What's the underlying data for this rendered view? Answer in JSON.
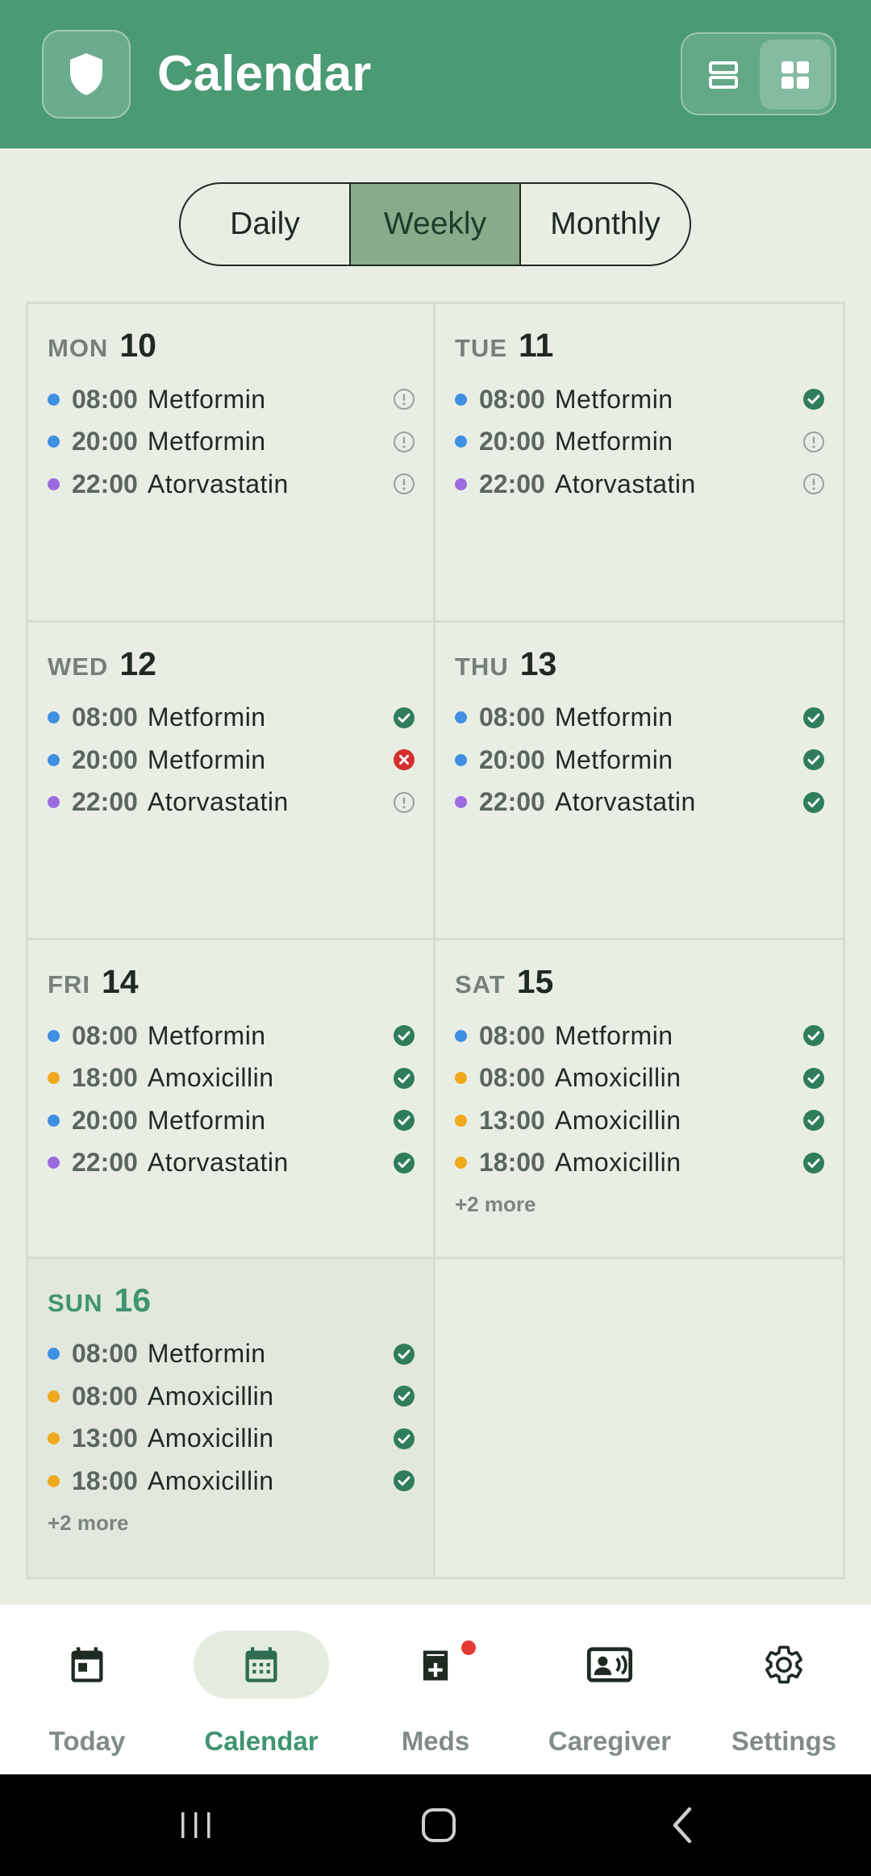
{
  "header": {
    "title": "Calendar",
    "icon": "shield-icon",
    "view_modes": [
      "list-view-icon",
      "grid-view-icon"
    ],
    "active_view": "grid",
    "bg_color": "#4a9a74"
  },
  "tabs": [
    {
      "label": "Daily",
      "active": false
    },
    {
      "label": "Weekly",
      "active": true
    },
    {
      "label": "Monthly",
      "active": false
    }
  ],
  "colors": {
    "metformin": "#3f8fe3",
    "atorvastatin": "#9b6ce0",
    "amoxicillin": "#f0a91c",
    "taken": "#2f7d5b",
    "missed": "#d32f2f",
    "pending": "#9aa29d"
  },
  "days": [
    {
      "dow": "MON",
      "num": "10",
      "today": false,
      "entries": [
        {
          "time": "08:00",
          "med": "Metformin",
          "color": "metformin",
          "status": "pending"
        },
        {
          "time": "20:00",
          "med": "Metformin",
          "color": "metformin",
          "status": "pending"
        },
        {
          "time": "22:00",
          "med": "Atorvastatin",
          "color": "atorvastatin",
          "status": "pending"
        }
      ],
      "more": ""
    },
    {
      "dow": "TUE",
      "num": "11",
      "today": false,
      "entries": [
        {
          "time": "08:00",
          "med": "Metformin",
          "color": "metformin",
          "status": "taken"
        },
        {
          "time": "20:00",
          "med": "Metformin",
          "color": "metformin",
          "status": "pending"
        },
        {
          "time": "22:00",
          "med": "Atorvastatin",
          "color": "atorvastatin",
          "status": "pending"
        }
      ],
      "more": ""
    },
    {
      "dow": "WED",
      "num": "12",
      "today": false,
      "entries": [
        {
          "time": "08:00",
          "med": "Metformin",
          "color": "metformin",
          "status": "taken"
        },
        {
          "time": "20:00",
          "med": "Metformin",
          "color": "metformin",
          "status": "missed"
        },
        {
          "time": "22:00",
          "med": "Atorvastatin",
          "color": "atorvastatin",
          "status": "pending"
        }
      ],
      "more": ""
    },
    {
      "dow": "THU",
      "num": "13",
      "today": false,
      "entries": [
        {
          "time": "08:00",
          "med": "Metformin",
          "color": "metformin",
          "status": "taken"
        },
        {
          "time": "20:00",
          "med": "Metformin",
          "color": "metformin",
          "status": "taken"
        },
        {
          "time": "22:00",
          "med": "Atorvastatin",
          "color": "atorvastatin",
          "status": "taken"
        }
      ],
      "more": ""
    },
    {
      "dow": "FRI",
      "num": "14",
      "today": false,
      "entries": [
        {
          "time": "08:00",
          "med": "Metformin",
          "color": "metformin",
          "status": "taken"
        },
        {
          "time": "18:00",
          "med": "Amoxicillin",
          "color": "amoxicillin",
          "status": "taken"
        },
        {
          "time": "20:00",
          "med": "Metformin",
          "color": "metformin",
          "status": "taken"
        },
        {
          "time": "22:00",
          "med": "Atorvastatin",
          "color": "atorvastatin",
          "status": "taken"
        }
      ],
      "more": ""
    },
    {
      "dow": "SAT",
      "num": "15",
      "today": false,
      "entries": [
        {
          "time": "08:00",
          "med": "Metformin",
          "color": "metformin",
          "status": "taken"
        },
        {
          "time": "08:00",
          "med": "Amoxicillin",
          "color": "amoxicillin",
          "status": "taken"
        },
        {
          "time": "13:00",
          "med": "Amoxicillin",
          "color": "amoxicillin",
          "status": "taken"
        },
        {
          "time": "18:00",
          "med": "Amoxicillin",
          "color": "amoxicillin",
          "status": "taken"
        }
      ],
      "more": "+2 more"
    },
    {
      "dow": "SUN",
      "num": "16",
      "today": true,
      "entries": [
        {
          "time": "08:00",
          "med": "Metformin",
          "color": "metformin",
          "status": "taken"
        },
        {
          "time": "08:00",
          "med": "Amoxicillin",
          "color": "amoxicillin",
          "status": "taken"
        },
        {
          "time": "13:00",
          "med": "Amoxicillin",
          "color": "amoxicillin",
          "status": "taken"
        },
        {
          "time": "18:00",
          "med": "Amoxicillin",
          "color": "amoxicillin",
          "status": "taken"
        }
      ],
      "more": "+2 more"
    }
  ],
  "nav": [
    {
      "label": "Today",
      "icon": "calendar-day-icon",
      "active": false,
      "badge": false
    },
    {
      "label": "Calendar",
      "icon": "calendar-month-icon",
      "active": true,
      "badge": false
    },
    {
      "label": "Meds",
      "icon": "medkit-icon",
      "active": false,
      "badge": true
    },
    {
      "label": "Caregiver",
      "icon": "contact-card-icon",
      "active": false,
      "badge": false
    },
    {
      "label": "Settings",
      "icon": "gear-icon",
      "active": false,
      "badge": false
    }
  ],
  "system_nav": [
    "recents-icon",
    "home-icon",
    "back-icon"
  ]
}
